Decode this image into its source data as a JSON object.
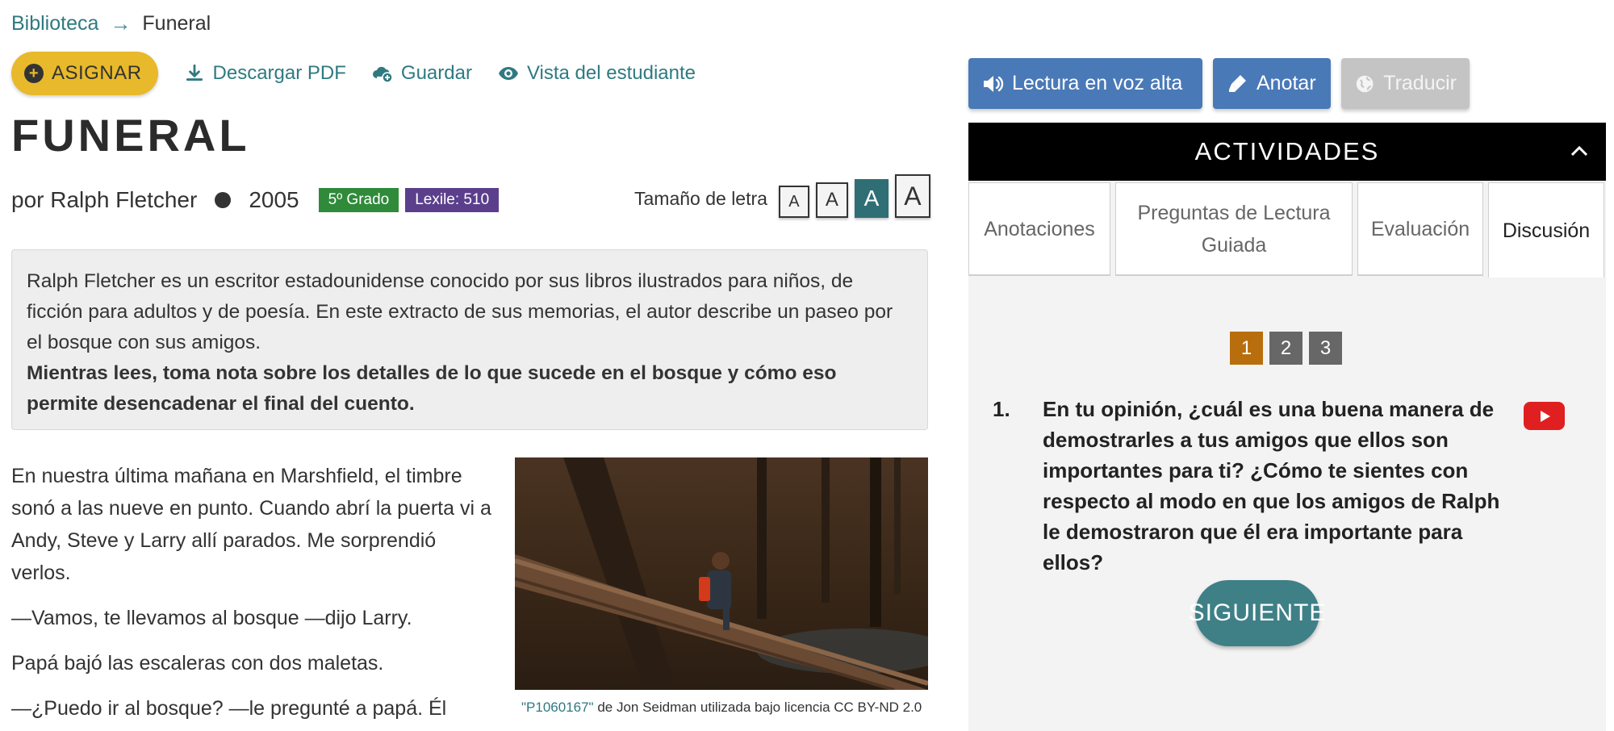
{
  "breadcrumb": {
    "library": "Biblioteca",
    "current": "Funeral"
  },
  "actions": {
    "assign": "ASIGNAR",
    "download": "Descargar PDF",
    "save": "Guardar",
    "student_view": "Vista del estudiante"
  },
  "title": "FUNERAL",
  "meta": {
    "author": "por Ralph Fletcher",
    "year": "2005",
    "grade": "5º Grado",
    "lexile": "Lexile: 510"
  },
  "font_size": {
    "label": "Tamaño de letra",
    "options": [
      "A",
      "A",
      "A",
      "A"
    ],
    "selected_index": 2
  },
  "intro": {
    "text": "Ralph Fletcher es un escritor estadounidense conocido por sus libros ilustrados para niños, de ficción para adultos y de poesía. En este extracto de sus memorias, el autor describe un paseo por el bosque con sus amigos.",
    "instruction": "Mientras lees, toma nota sobre los detalles de lo que sucede en el bosque y cómo eso permite desencadenar el final del cuento."
  },
  "story": {
    "paragraphs": [
      "En nuestra última mañana en Marshfield, el timbre sonó a las nueve en punto. Cuando abrí la puerta vi a Andy, Steve y Larry allí parados. Me sorprendió verlos.",
      "—Vamos, te llevamos al bosque —dijo Larry.",
      "Papá bajó las escaleras con dos maletas.",
      "—¿Puedo ir al bosque? —le pregunté a papá. Él"
    ]
  },
  "image_caption": {
    "link": "\"P1060167\"",
    "text": " de Jon Seidman utilizada bajo licencia CC BY-ND 2.0"
  },
  "tools": {
    "read_aloud": "Lectura en voz alta",
    "annotate": "Anotar",
    "translate": "Traducir"
  },
  "activities": {
    "header": "ACTIVIDADES",
    "tabs": [
      "Anotaciones",
      "Preguntas de Lectura Guiada",
      "Evaluación",
      "Discusión"
    ],
    "active_tab": "Discusión",
    "pages": [
      "1",
      "2",
      "3"
    ],
    "active_page": "1",
    "question_number": "1.",
    "question": "En tu opinión, ¿cuál es una buena manera de demostrarles a tus amigos que ellos son importantes para ti? ¿Cómo te sientes con respecto al modo en que los amigos de Ralph le demostraron que él era importante para ellos?",
    "next": "SIGUIENTE"
  },
  "colors": {
    "link": "#2f7a80",
    "assign": "#e8b92a",
    "grade_badge": "#2f8a3a",
    "lexile_badge": "#5b3f8c",
    "tool_blue": "#4a79b7",
    "active_page": "#b86e0d",
    "next_button": "#3f8087"
  }
}
